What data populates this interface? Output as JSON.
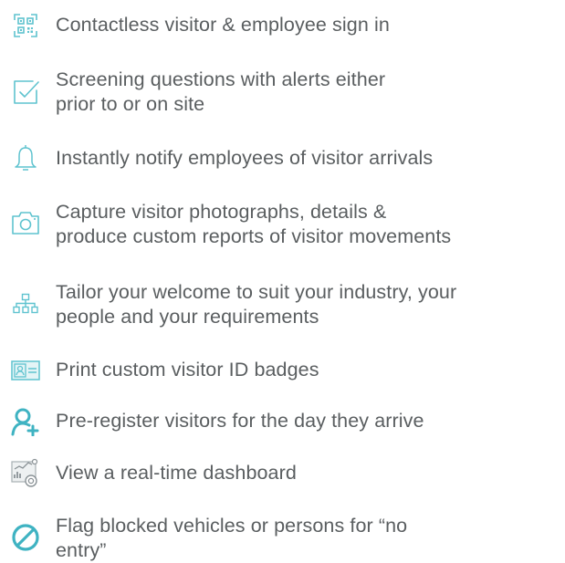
{
  "colors": {
    "icon_teal": "#5fc3cf",
    "icon_teal_dark": "#3fb3c2",
    "text": "#5a5e60",
    "icon_grey": "#8a9296"
  },
  "features": [
    {
      "icon": "qr-code-icon",
      "lines": [
        "Contactless visitor & employee sign in"
      ]
    },
    {
      "icon": "checkbox-icon",
      "lines": [
        "Screening questions with alerts either",
        "prior to or on site"
      ]
    },
    {
      "icon": "bell-icon",
      "lines": [
        "Instantly notify employees of visitor arrivals"
      ]
    },
    {
      "icon": "camera-icon",
      "lines": [
        "Capture visitor photographs, details &",
        "produce custom reports of visitor movements"
      ]
    },
    {
      "icon": "org-chart-icon",
      "lines": [
        "Tailor your welcome to suit your industry, your",
        "people and your requirements"
      ]
    },
    {
      "icon": "id-badge-icon",
      "lines": [
        "Print custom visitor ID badges"
      ]
    },
    {
      "icon": "add-person-icon",
      "lines": [
        "Pre-register visitors for the day they arrive"
      ]
    },
    {
      "icon": "dashboard-icon",
      "lines": [
        "View a real-time dashboard"
      ]
    },
    {
      "icon": "no-entry-icon",
      "lines": [
        "Flag blocked vehicles or persons for “no",
        "entry”"
      ]
    }
  ]
}
